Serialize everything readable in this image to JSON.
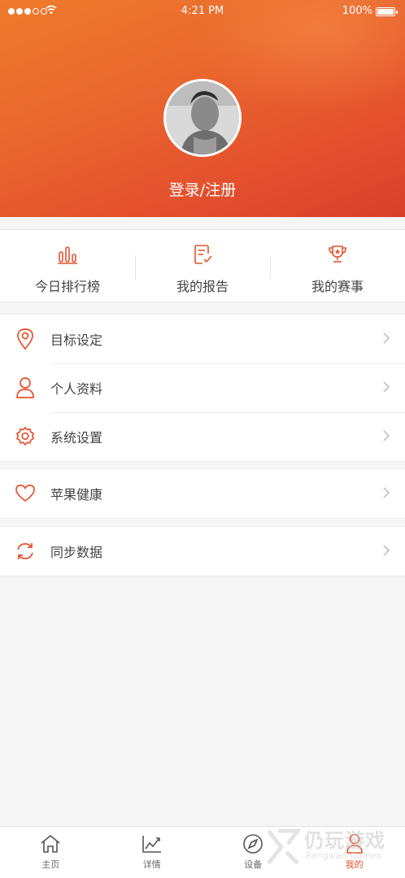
{
  "status_bar": {
    "time": "4:21 PM",
    "battery": "100%"
  },
  "profile": {
    "login_label": "登录/注册"
  },
  "shortcuts": [
    {
      "label": "今日排行榜",
      "icon": "bar-chart-icon"
    },
    {
      "label": "我的报告",
      "icon": "report-icon"
    },
    {
      "label": "我的赛事",
      "icon": "trophy-icon"
    }
  ],
  "menu_groups": [
    [
      {
        "label": "目标设定",
        "icon": "location-pin-icon"
      },
      {
        "label": "个人资料",
        "icon": "person-icon"
      },
      {
        "label": "系统设置",
        "icon": "gear-icon"
      }
    ],
    [
      {
        "label": "苹果健康",
        "icon": "heart-icon"
      }
    ],
    [
      {
        "label": "同步数据",
        "icon": "sync-icon"
      }
    ]
  ],
  "tabbar": [
    {
      "label": "主页",
      "icon": "home-icon"
    },
    {
      "label": "详情",
      "icon": "line-chart-icon"
    },
    {
      "label": "设备",
      "icon": "compass-icon"
    },
    {
      "label": "我的",
      "icon": "person-icon",
      "active": true
    }
  ],
  "watermark": {
    "cn": "仍玩游戏",
    "en": "Rengwan Games"
  },
  "colors": {
    "accent": "#e4522e",
    "header_start": "#ee7a2c",
    "header_end": "#d9402a"
  }
}
